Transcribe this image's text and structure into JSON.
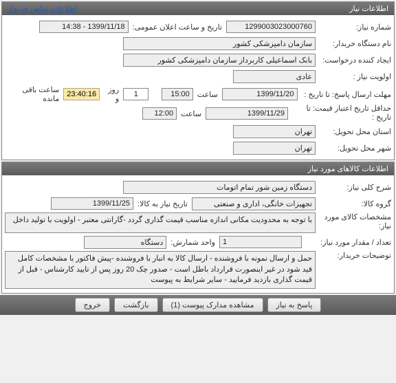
{
  "panel1": {
    "title": "اطلاعات نیاز",
    "contact_link": "اطلاعات تماس خریدار",
    "request_no_label": "شماره نیاز:",
    "request_no": "1299003023000760",
    "public_date_label": "تاریخ و ساعت اعلان عمومی:",
    "public_date": "1399/11/18 - 14:38",
    "org_label": "نام دستگاه خریدار:",
    "org": "سازمان دامپزشکی کشور",
    "requester_label": "ایجاد کننده درخواست:",
    "requester": "بابک اسماعیلی کاربرداز سازمان دامپزشکی کشور",
    "priority_label": "اولویت نیاز :",
    "priority": "عادی",
    "deadline_label": "مهلت ارسال پاسخ:",
    "to_date_label": "تا تاریخ :",
    "deadline_date": "1399/11/20",
    "time_label": "ساعت",
    "deadline_time": "15:00",
    "days": "1",
    "days_label": "روز و",
    "remaining_time": "23:40:16",
    "remaining_label": "ساعت باقی مانده",
    "min_valid_label": "حداقل تاریخ اعتبار قیمت:",
    "min_valid_date": "1399/11/29",
    "min_valid_time": "12:00",
    "delivery_province_label": "استان محل تحویل:",
    "delivery_province": "تهران",
    "delivery_city_label": "شهر محل تحویل:",
    "delivery_city": "تهران"
  },
  "panel2": {
    "title": "اطلاعات کالاهای مورد نیاز",
    "general_desc_label": "شرح کلی نیاز:",
    "general_desc": "دستگاه زمین شور تمام اتومات",
    "group_label": "گروه کالا:",
    "group": "تجهیزات خانگی، اداری و صنعتی",
    "need_to_label": "تاریخ نیاز به کالا:",
    "need_to": "1399/11/25",
    "specs_label": "مشخصات کالای مورد نیاز:",
    "specs": "با توجه به محدودیت مکانی اندازه مناسب قیمت گذاری گردد -گارانتی معتبر -  اولویت با تولید داخل",
    "qty_label": "تعداد / مقدار مورد نیاز:",
    "qty": "1",
    "unit_label": "واحد شمارش:",
    "unit": "دستگاه",
    "buyer_notes_label": "توضیحات خریدار:",
    "buyer_notes": "حمل و ارسال نمونه با فروشنده - ارسال کالا به انبار با فروشنده -پیش فاکتور با مشخصات کامل قید شود در غیر اینصورت قرارداد باطل است - صدور چک 20 روز پس از تایید کارشناس - قبل از قیمت گذاری بازدید فرمایید - سایر شرایط به پیوست"
  },
  "footer": {
    "reply": "پاسخ به نیاز",
    "view_docs": "مشاهده مدارک پیوست (1)",
    "back": "بازگشت",
    "exit": "خروج"
  }
}
